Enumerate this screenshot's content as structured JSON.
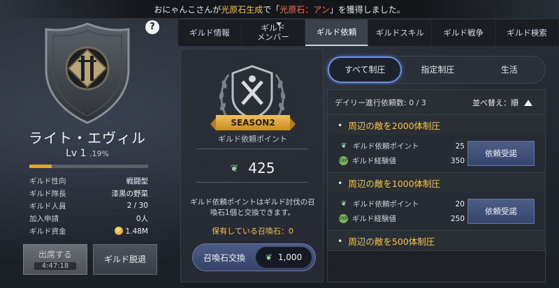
{
  "notice": {
    "prefix": "おにゃんこさんが",
    "highlight": "光原石生成",
    "mid": "で「",
    "item": "光原石：アン",
    "suffix": "」を獲得しました。"
  },
  "guild": {
    "help_label": "?",
    "name": "ライト・エヴィル",
    "level": "Lv 1",
    "level_pct": ".19%",
    "xp_fraction": 0.19,
    "stats": [
      {
        "key": "ギルド性向",
        "value": "戦闘型"
      },
      {
        "key": "ギルド隊長",
        "value": "漆黒の野菜"
      },
      {
        "key": "ギルド人員",
        "value": "2 / 30"
      },
      {
        "key": "加入申請",
        "value": "0人"
      },
      {
        "key": "ギルド資金",
        "value": "1.48M"
      }
    ],
    "attend_label": "出席する",
    "attend_timer": "4:47:18",
    "leave_label": "ギルド脱退"
  },
  "tabs": [
    {
      "label": "ギルド情報"
    },
    {
      "label": "ギルド\nメンバー"
    },
    {
      "label": "ギルド依頼"
    },
    {
      "label": "ギルドスキル"
    },
    {
      "label": "ギルド戦争"
    },
    {
      "label": "ギルド検索"
    }
  ],
  "active_tab": 2,
  "points": {
    "season": "SEASON2",
    "label": "ギルド依頼ポイント",
    "value": "425",
    "desc": "ギルド依頼ポイントはギルド討伐の召喚石1個と交換できます。",
    "owned": "保有している召喚石：",
    "owned_count": "0",
    "exchange_label": "召喚石交換",
    "exchange_cost": "1,000"
  },
  "filters": [
    {
      "label": "すべて制圧"
    },
    {
      "label": "指定制圧"
    },
    {
      "label": "生活"
    }
  ],
  "active_filter": 0,
  "list": {
    "daily_label": "デイリー進行依頼数:",
    "daily_value": "0 / 3",
    "sort_label": "並べ替え：順"
  },
  "quests": [
    {
      "title": "周辺の敵を2000体制圧",
      "point_label": "ギルド依頼ポイント",
      "point_value": "25",
      "exp_label": "ギルド経験値",
      "exp_value": "350",
      "accept_label": "依頼受諾"
    },
    {
      "title": "周辺の敵を1000体制圧",
      "point_label": "ギルド依頼ポイント",
      "point_value": "20",
      "exp_label": "ギルド経験値",
      "exp_value": "250",
      "accept_label": "依頼受諾"
    },
    {
      "title": "周辺の敵を500体制圧"
    }
  ],
  "colors": {
    "accent_gold": "#f3c64d",
    "highlight_red": "#ff6a4d",
    "filter_glow": "#6e8fe0"
  }
}
